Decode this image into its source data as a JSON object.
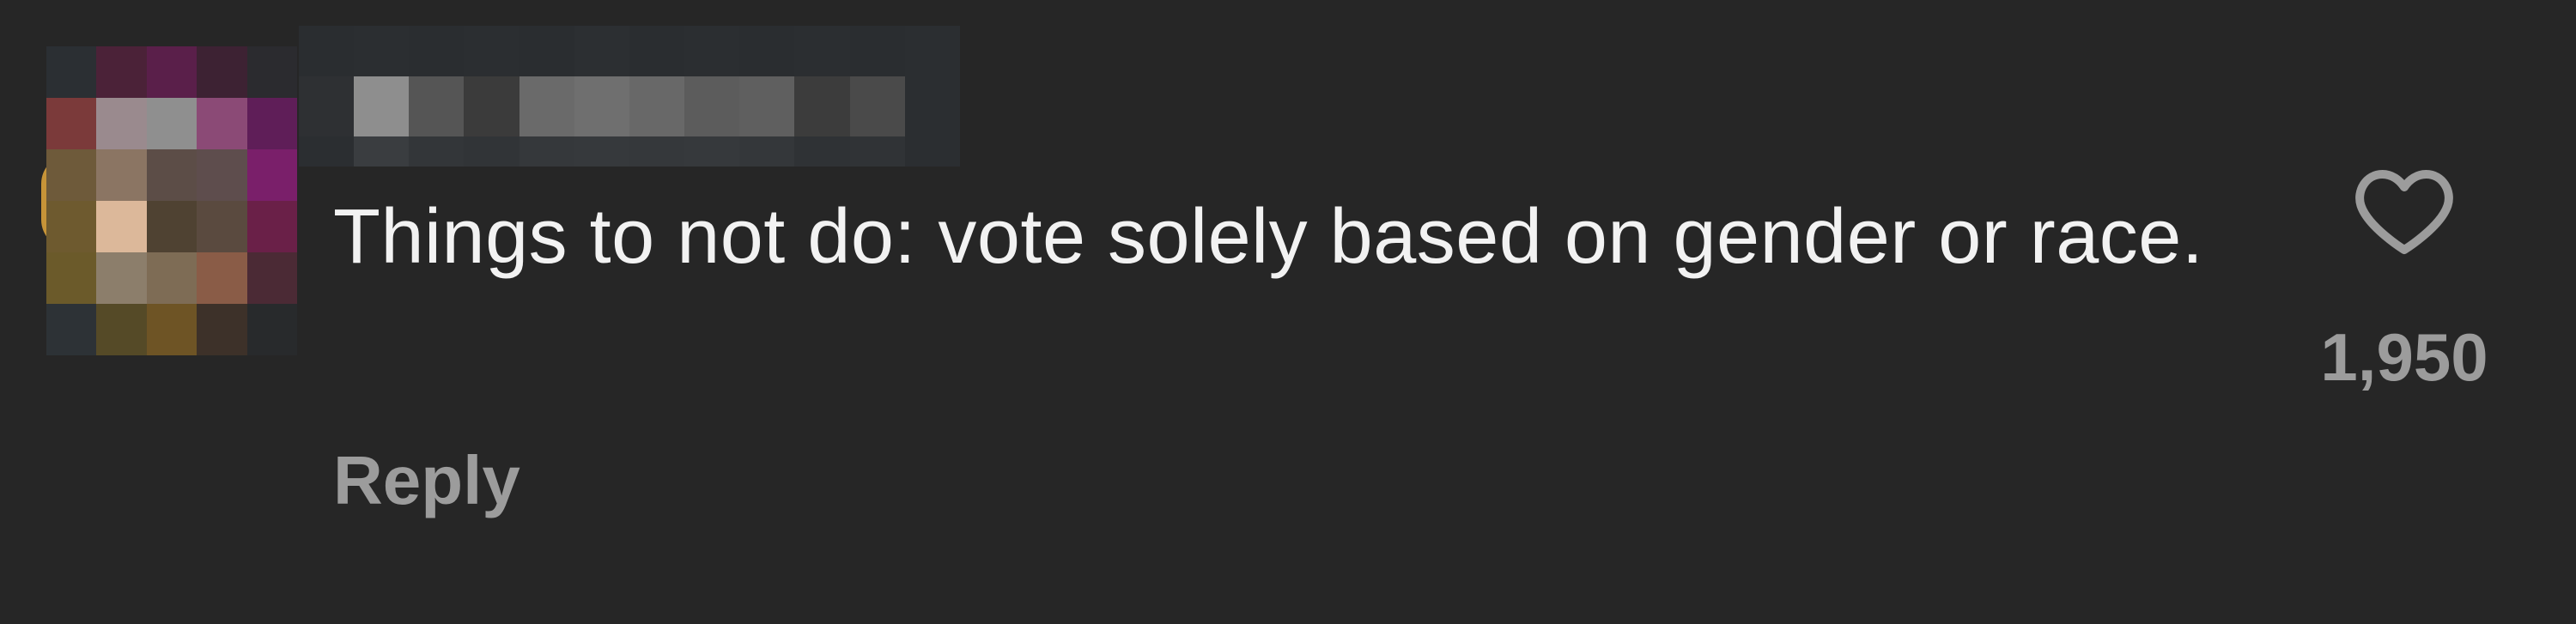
{
  "comment": {
    "text": "Things to not do: vote solely based on gender or race.",
    "reply_label": "Reply",
    "like_count": "1,950"
  },
  "colors": {
    "background": "#262626",
    "text_primary": "#f2f2f2",
    "text_secondary": "#9c9c9c"
  },
  "icons": {
    "like": "heart-outline-icon"
  }
}
